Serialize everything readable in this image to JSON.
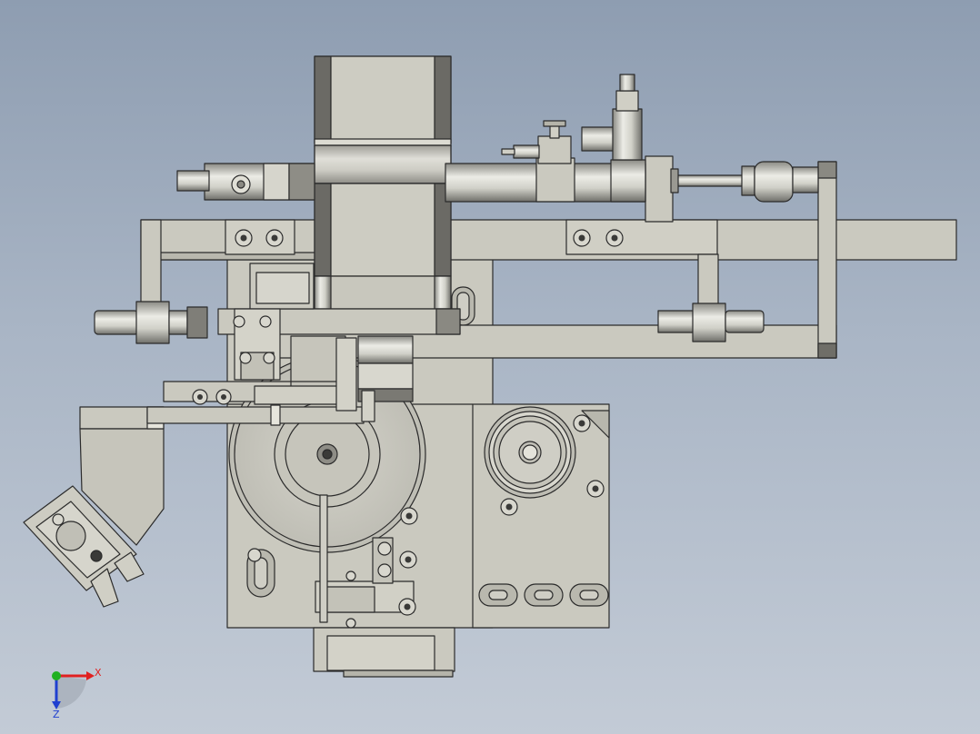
{
  "view": {
    "type": "cad-orthographic-front-view",
    "background_top": "#8e9db1",
    "background_bottom": "#c3cbd6",
    "part_fill": "#cac9bf",
    "part_fill_dark": "#b5b4aa",
    "edge_color": "#2b2b2b",
    "metal_light": "#e2e2dc",
    "metal_dark": "#6d6d68"
  },
  "triad": {
    "x_label": "X",
    "z_label": "Z",
    "x_color": "#e02020",
    "z_color": "#2040d0",
    "y_color": "#20b020"
  }
}
